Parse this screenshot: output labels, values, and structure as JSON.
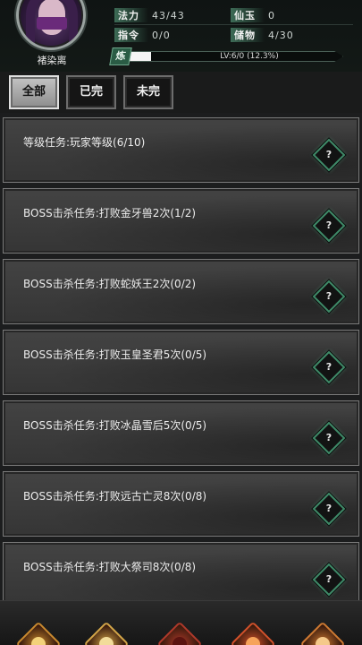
{
  "player": {
    "name": "褚染离",
    "avatar_icon": "masked-character-portrait"
  },
  "stats": {
    "mana": {
      "label": "法力",
      "value": "43/43"
    },
    "immortal_jade": {
      "label": "仙玉",
      "value": "0"
    },
    "command": {
      "label": "指令",
      "value": "0/0"
    },
    "storage": {
      "label": "储物",
      "value": "4/30"
    }
  },
  "exp": {
    "badge": "炼",
    "text": "LV:6/0 (12.3%)",
    "progress": 0.123
  },
  "tabs": [
    {
      "label": "全部",
      "active": true
    },
    {
      "label": "已完",
      "active": false
    },
    {
      "label": "未完",
      "active": false
    }
  ],
  "quests": [
    {
      "text": "等级任务:玩家等级(6/10)",
      "help": "?"
    },
    {
      "text": "BOSS击杀任务:打败金牙兽2次(1/2)",
      "help": "?"
    },
    {
      "text": "BOSS击杀任务:打败蛇妖王2次(0/2)",
      "help": "?"
    },
    {
      "text": "BOSS击杀任务:打败玉皇圣君5次(0/5)",
      "help": "?"
    },
    {
      "text": "BOSS击杀任务:打败冰晶雪后5次(0/5)",
      "help": "?"
    },
    {
      "text": "BOSS击杀任务:打败远古亡灵8次(0/8)",
      "help": "?"
    },
    {
      "text": "BOSS击杀任务:打败大祭司8次(0/8)",
      "help": "?"
    }
  ],
  "bottom_nav": [
    {
      "icon": "flame-emblem-icon",
      "color": "#c9892e"
    },
    {
      "icon": "golden-helm-icon",
      "color": "#d3a548"
    },
    {
      "icon": "red-gate-icon",
      "color": "#b0392a"
    },
    {
      "icon": "fire-wing-icon",
      "color": "#d2512a"
    },
    {
      "icon": "sun-seal-icon",
      "color": "#cf7a32"
    }
  ],
  "colors": {
    "accent_green": "#3f8a68",
    "panel_bg": "#3c3c3c",
    "tab_active": "#b0b0b0"
  }
}
